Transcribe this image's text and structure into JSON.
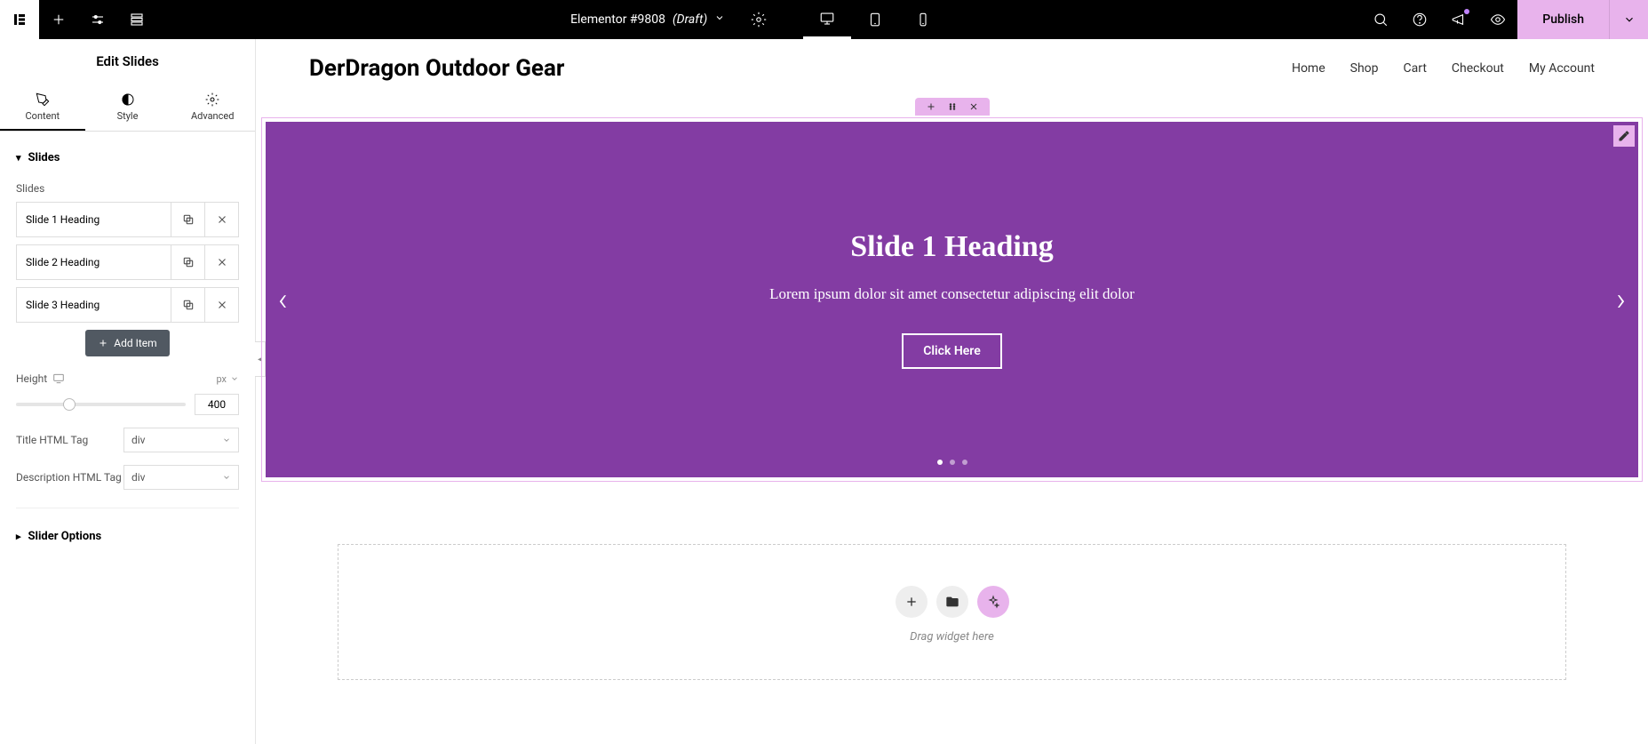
{
  "topbar": {
    "doc_name": "Elementor #9808",
    "status": "(Draft)",
    "publish_label": "Publish"
  },
  "sidebar": {
    "title": "Edit Slides",
    "tabs": {
      "content": "Content",
      "style": "Style",
      "advanced": "Advanced"
    },
    "section_slides": "Slides",
    "slides_label": "Slides",
    "items": [
      {
        "label": "Slide 1 Heading"
      },
      {
        "label": "Slide 2 Heading"
      },
      {
        "label": "Slide 3 Heading"
      }
    ],
    "add_item": "Add Item",
    "height_label": "Height",
    "height_unit": "px",
    "height_value": "400",
    "title_tag_label": "Title HTML Tag",
    "title_tag_value": "div",
    "desc_tag_label": "Description HTML Tag",
    "desc_tag_value": "div",
    "section_slider_options": "Slider Options"
  },
  "site": {
    "title": "DerDragon Outdoor Gear",
    "nav": [
      "Home",
      "Shop",
      "Cart",
      "Checkout",
      "My Account"
    ]
  },
  "slide": {
    "heading": "Slide 1 Heading",
    "description": "Lorem ipsum dolor sit amet consectetur adipiscing elit dolor",
    "button": "Click Here"
  },
  "drop": {
    "text": "Drag widget here"
  }
}
